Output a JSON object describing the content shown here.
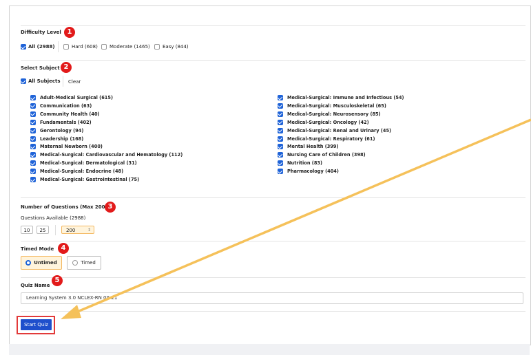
{
  "difficulty": {
    "title": "Difficulty Level",
    "badge": "1",
    "options": [
      {
        "label": "All (2988)",
        "checked": true
      },
      {
        "label": "Hard (608)",
        "checked": false
      },
      {
        "label": "Moderate (1465)",
        "checked": false
      },
      {
        "label": "Easy (844)",
        "checked": false
      }
    ]
  },
  "subject": {
    "title": "Select Subject",
    "badge": "2",
    "all_label": "All Subjects",
    "clear_label": "Clear",
    "left": [
      "Adult-Medical Surgical (615)",
      "Communication (63)",
      "Community Health (40)",
      "Fundamentals (402)",
      "Gerontology (94)",
      "Leadership (168)",
      "Maternal Newborn (400)",
      "Medical-Surgical: Cardiovascular and Hematology (112)",
      "Medical-Surgical: Dermatological (31)",
      "Medical-Surgical: Endocrine (48)",
      "Medical-Surgical: Gastrointestinal (75)"
    ],
    "right": [
      "Medical-Surgical: Immune and Infectious (54)",
      "Medical-Surgical: Musculoskeletal (65)",
      "Medical-Surgical: Neurosensory (85)",
      "Medical-Surgical: Oncology (42)",
      "Medical-Surgical: Renal and Urinary (45)",
      "Medical-Surgical: Respiratory (61)",
      "Mental Health (399)",
      "Nursing Care of Children (398)",
      "Nutrition (83)",
      "Pharmacology (404)"
    ]
  },
  "questions": {
    "title": "Number of Questions (Max 200)",
    "badge": "3",
    "available": "Questions Available (2988)",
    "preset_10": "10",
    "preset_25": "25",
    "value": "200"
  },
  "timed": {
    "title": "Timed Mode",
    "badge": "4",
    "untimed_label": "Untimed",
    "timed_label": "Timed"
  },
  "quiz": {
    "title": "Quiz Name",
    "badge": "5",
    "name_value": "Learning System 3.0 NCLEX-RN 09-21",
    "start_label": "Start Quiz"
  },
  "colors": {
    "accent": "#1f63d8",
    "badge": "#e21a1a",
    "arrow": "#f5c15a"
  }
}
